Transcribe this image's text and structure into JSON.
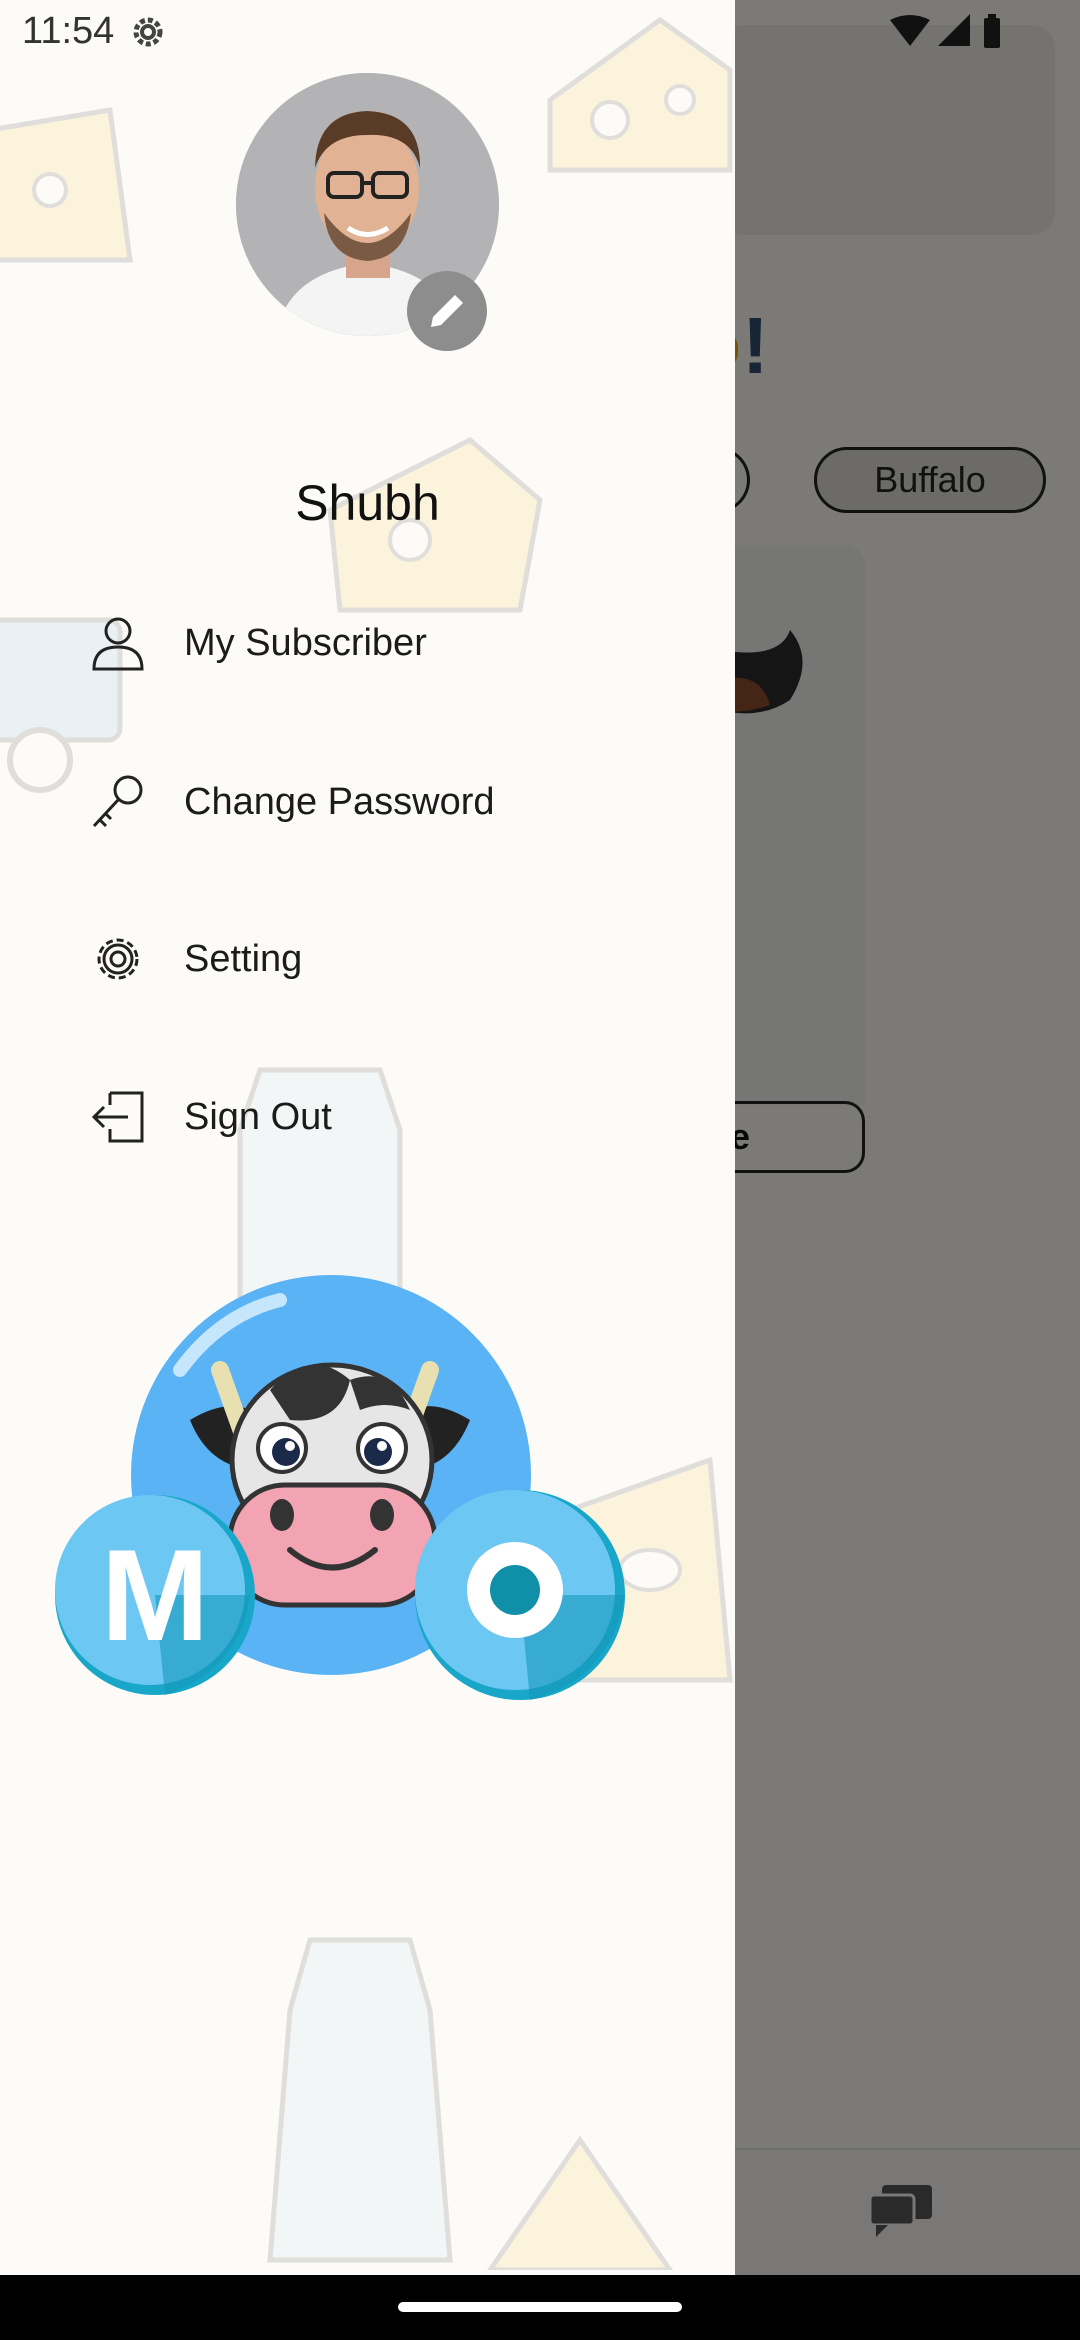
{
  "status_bar": {
    "time": "11:54",
    "icons": [
      "settings-gear-icon",
      "wifi-icon",
      "signal-icon",
      "battery-icon"
    ]
  },
  "drawer": {
    "user_name": "Shubh",
    "menu": [
      {
        "label": "My Subscriber",
        "icon": "person-icon"
      },
      {
        "label": "Change Password",
        "icon": "key-icon"
      },
      {
        "label": "Setting",
        "icon": "gear-icon"
      },
      {
        "label": "Sign Out",
        "icon": "sign-out-icon"
      }
    ],
    "logo_letters": [
      "M",
      "O"
    ]
  },
  "background_screen": {
    "chip_buffalo": "Buffalo",
    "button_partial": "e",
    "exclaim": "!"
  },
  "colors": {
    "drawer_bg": "#fdfbf7",
    "scrim": "#000000",
    "logo_blue": "#5ab3f5",
    "logo_teal": "#19a7c9"
  }
}
